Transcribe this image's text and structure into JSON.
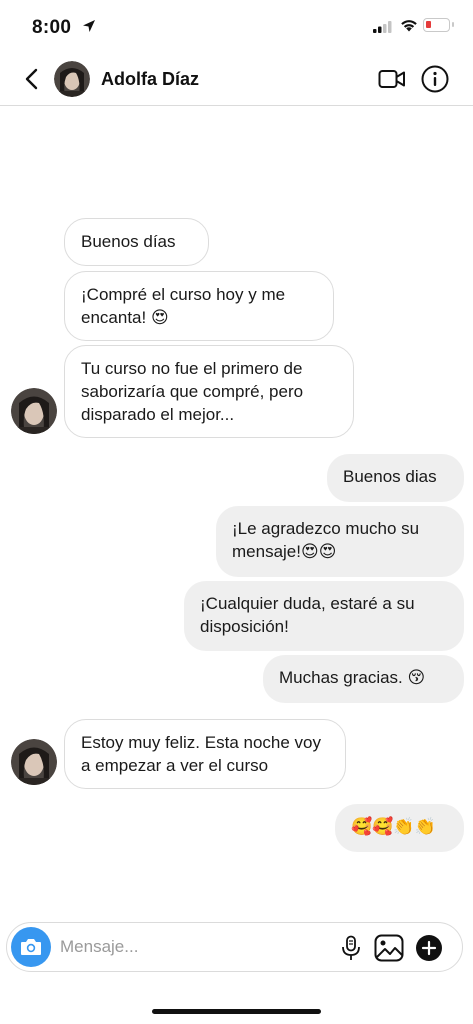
{
  "status_bar": {
    "time": "8:00"
  },
  "header": {
    "contact_name": "Adolfa Díaz"
  },
  "messages": [
    {
      "id": "m1",
      "direction": "incoming",
      "text": "Buenos días"
    },
    {
      "id": "m2",
      "direction": "incoming",
      "text": "¡Compré el curso hoy y me encanta! 😍"
    },
    {
      "id": "m3",
      "direction": "incoming",
      "text": "Tu curso no fue el primero de saborizaría que compré, pero disparado el mejor..."
    },
    {
      "id": "m4",
      "direction": "outgoing",
      "text": "Buenos dias"
    },
    {
      "id": "m5",
      "direction": "outgoing",
      "text": "¡Le agradezco mucho su mensaje!😍😍"
    },
    {
      "id": "m6",
      "direction": "outgoing",
      "text": "¡Cualquier duda, estaré a su disposición!"
    },
    {
      "id": "m7",
      "direction": "outgoing",
      "text": "Muchas gracias. 😚"
    },
    {
      "id": "m8",
      "direction": "incoming",
      "text": "Estoy muy feliz. Esta noche voy a empezar a ver el curso"
    },
    {
      "id": "m9",
      "direction": "outgoing",
      "text": "🥰🥰👏👏"
    }
  ],
  "composer": {
    "placeholder": "Mensaje..."
  },
  "icons": {
    "back": "chevron-left-icon",
    "video": "video-camera-icon",
    "info": "info-icon",
    "camera": "camera-icon",
    "mic": "microphone-icon",
    "gallery": "image-icon",
    "add": "plus-icon"
  },
  "colors": {
    "camera_button": "#3797f0",
    "battery_low": "#e53b3b"
  }
}
